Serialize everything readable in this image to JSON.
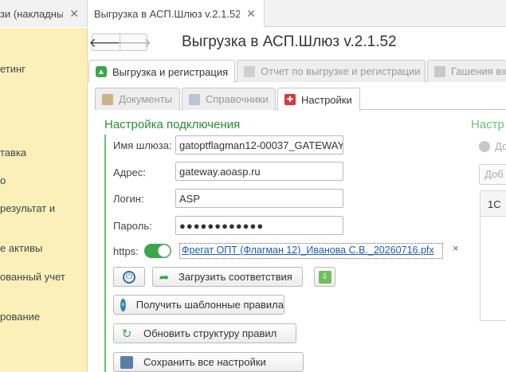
{
  "top_tabs": [
    {
      "label": "зи (накладные)",
      "active": false
    },
    {
      "label": "Выгрузка в АСП.Шлюз v.2.1.52",
      "active": true
    }
  ],
  "sidebar": {
    "items": [
      "етинг",
      "тавка",
      "о",
      "результат и",
      "е активы",
      "ованный учет",
      "рование"
    ]
  },
  "form": {
    "title": "Выгрузка в АСП.Шлюз v.2.1.52",
    "main_tabs": [
      {
        "label": "Выгрузка и регистрация",
        "active": true,
        "icon": "green-upload-icon"
      },
      {
        "label": "Отчет по выгрузке и регистрации",
        "active": false,
        "icon": "report-icon"
      },
      {
        "label": "Гашения вх",
        "active": false,
        "icon": "stamp-icon"
      }
    ],
    "sub_tabs": [
      {
        "label": "Документы",
        "active": false,
        "icon": "documents-icon"
      },
      {
        "label": "Справочники",
        "active": false,
        "icon": "catalogs-icon"
      },
      {
        "label": "Настройки",
        "active": true,
        "icon": "settings-icon"
      }
    ]
  },
  "connection": {
    "section_title": "Настройка подключения",
    "gateway_label": "Имя шлюза:",
    "gateway_value": "gatoptflagman12-00037_GATEWAY",
    "address_label": "Адрес:",
    "address_value": "gateway.aoasp.ru",
    "login_label": "Логин:",
    "login_value": "ASP",
    "password_label": "Пароль:",
    "password_value": "●●●●●●●●●●●●",
    "https_label": "https:",
    "https_enabled": true,
    "certificate": "Фрегат ОПТ (Флагман 12)_Иванова С.В._20260716.pfx",
    "remove_symbol": "×"
  },
  "buttons": {
    "load_mapping": "Загрузить соответствия",
    "get_templates": "Получить шаблонные правила",
    "update_rules": "Обновить структуру правил",
    "save_settings": "Сохранить все настройки"
  },
  "right_panel": {
    "title": "Настр",
    "subtitle": "До",
    "add_button": "Доб",
    "column_header": "1С"
  },
  "colors": {
    "accent_green": "#2c8a3a",
    "sidebar_bg": "#fbf0b9",
    "link": "#1c5bb8"
  }
}
